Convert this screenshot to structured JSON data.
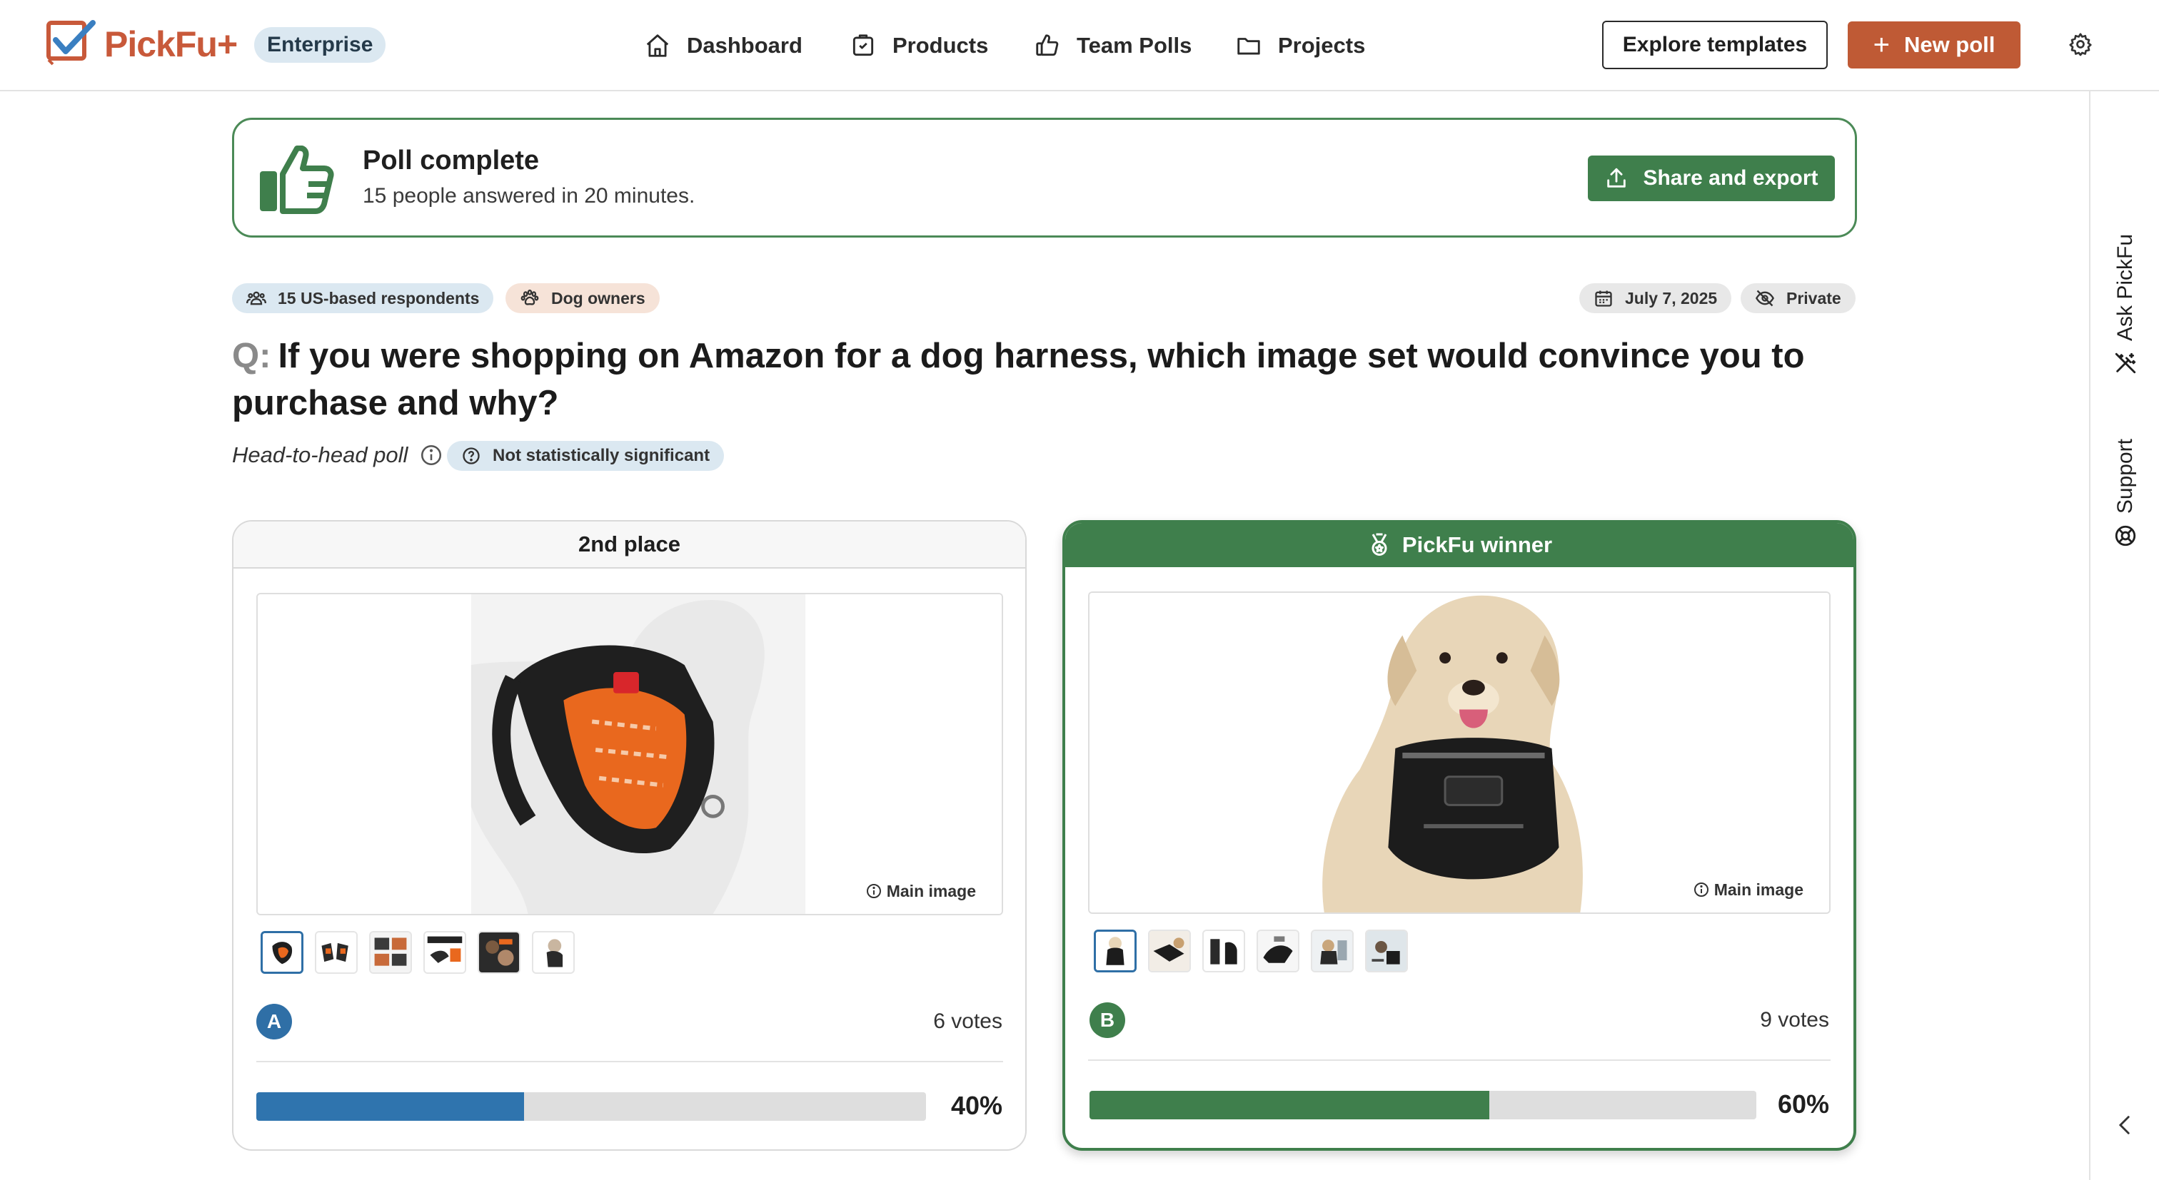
{
  "brand": {
    "logo_text": "PickFu",
    "logo_plus": "+",
    "plan_badge": "Enterprise",
    "color_primary": "#bf5a35",
    "color_success": "#3f7f4c",
    "color_option_a": "#2f74ae"
  },
  "nav": {
    "items": [
      {
        "label": "Dashboard",
        "icon": "home-icon"
      },
      {
        "label": "Products",
        "icon": "product-tag-icon"
      },
      {
        "label": "Team Polls",
        "icon": "thumbs-up-icon"
      },
      {
        "label": "Projects",
        "icon": "folder-icon"
      }
    ],
    "explore_label": "Explore templates",
    "new_poll_label": "New poll",
    "settings_icon": "gear-icon"
  },
  "rail": {
    "ask_label": "Ask PickFu",
    "support_label": "Support",
    "collapse_icon": "chevron-left-icon"
  },
  "banner": {
    "title": "Poll complete",
    "subtitle": "15 people answered in 20 minutes.",
    "share_label": "Share and export"
  },
  "meta": {
    "respondents": "15 US-based respondents",
    "audience": "Dog owners",
    "date": "July 7, 2025",
    "visibility": "Private"
  },
  "question": {
    "prefix": "Q:",
    "text": "If you were shopping on Amazon for a dog harness, which image set would convince you to purchase and why?",
    "poll_type": "Head-to-head poll",
    "significance": "Not statistically significant"
  },
  "options": [
    {
      "place_label": "2nd place",
      "letter": "A",
      "main_image_label": "Main image",
      "votes_label": "6 votes",
      "percent_label": "40%",
      "percent": 40,
      "thumbnail_count": 6
    },
    {
      "place_label": "PickFu winner",
      "letter": "B",
      "main_image_label": "Main image",
      "votes_label": "9 votes",
      "percent_label": "60%",
      "percent": 60,
      "thumbnail_count": 6
    }
  ]
}
